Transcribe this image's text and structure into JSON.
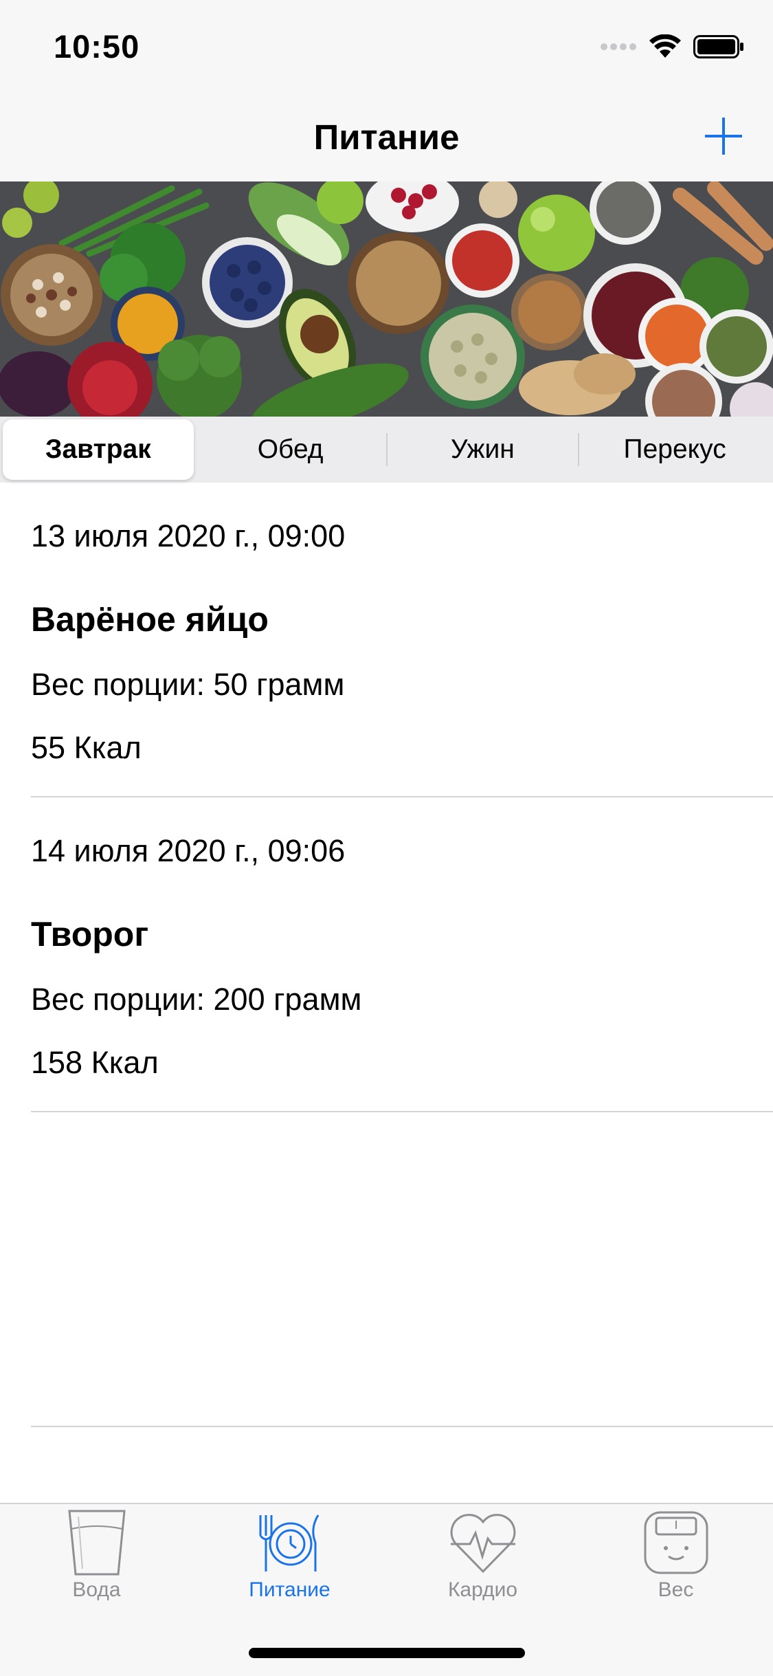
{
  "status_bar": {
    "time": "10:50"
  },
  "nav": {
    "title": "Питание",
    "add_icon": "plus-icon"
  },
  "segments": [
    {
      "label": "Завтрак",
      "selected": true
    },
    {
      "label": "Обед",
      "selected": false
    },
    {
      "label": "Ужин",
      "selected": false
    },
    {
      "label": "Перекус",
      "selected": false
    }
  ],
  "entries": [
    {
      "date": "13 июля 2020 г., 09:00",
      "name": "Варёное яйцо",
      "weight": "Вес порции: 50 грамм",
      "kcal": "55 Ккал"
    },
    {
      "date": "14 июля 2020 г., 09:06",
      "name": "Творог",
      "weight": "Вес порции: 200 грамм",
      "kcal": "158 Ккал"
    }
  ],
  "tabs": [
    {
      "label": "Вода",
      "icon": "water-glass-icon",
      "active": false
    },
    {
      "label": "Питание",
      "icon": "plate-icon",
      "active": true
    },
    {
      "label": "Кардио",
      "icon": "heart-pulse-icon",
      "active": false
    },
    {
      "label": "Вес",
      "icon": "scale-icon",
      "active": false
    }
  ],
  "colors": {
    "accent": "#1a73e8",
    "inactive": "#8e8e93",
    "bar_bg": "#f7f7f7"
  }
}
